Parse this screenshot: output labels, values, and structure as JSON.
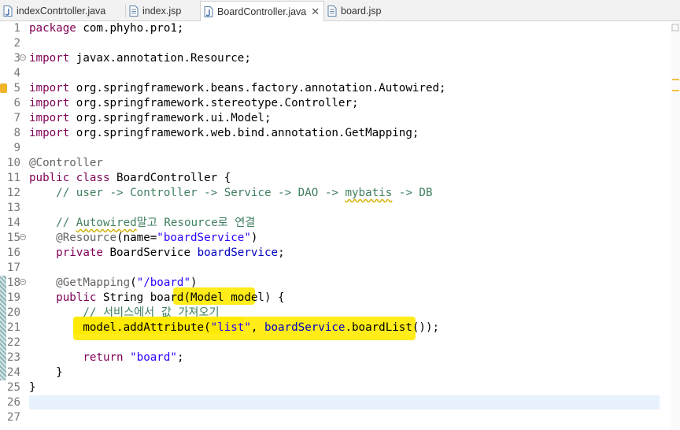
{
  "tabs": [
    {
      "label": "indexContrtoller.java",
      "type": "java",
      "active": false
    },
    {
      "label": "index.jsp",
      "type": "jsp",
      "active": false
    },
    {
      "label": "BoardController.java",
      "type": "java",
      "active": true
    },
    {
      "label": "board.jsp",
      "type": "jsp",
      "active": false
    }
  ],
  "editor": {
    "close_glyph": "✕",
    "current_line": 26,
    "highlight_color": "#ffea00",
    "lines": [
      {
        "n": "1",
        "tokens": [
          [
            "kw",
            "package"
          ],
          [
            "p",
            " com.phyho.pro1;"
          ]
        ]
      },
      {
        "n": "2",
        "tokens": []
      },
      {
        "n": "3",
        "fold": true,
        "tokens": [
          [
            "kw",
            "import"
          ],
          [
            "p",
            " javax.annotation.Resource;"
          ]
        ]
      },
      {
        "n": "4",
        "tokens": []
      },
      {
        "n": "5",
        "warn": true,
        "tokens": [
          [
            "kw",
            "import"
          ],
          [
            "p",
            " org.springframework.beans.factory.annotation.Autowired;"
          ]
        ]
      },
      {
        "n": "6",
        "tokens": [
          [
            "kw",
            "import"
          ],
          [
            "p",
            " org.springframework.stereotype.Controller;"
          ]
        ]
      },
      {
        "n": "7",
        "tokens": [
          [
            "kw",
            "import"
          ],
          [
            "p",
            " org.springframework.ui.Model;"
          ]
        ]
      },
      {
        "n": "8",
        "tokens": [
          [
            "kw",
            "import"
          ],
          [
            "p",
            " org.springframework.web.bind.annotation.GetMapping;"
          ]
        ]
      },
      {
        "n": "9",
        "tokens": []
      },
      {
        "n": "10",
        "tokens": [
          [
            "ann",
            "@Controller"
          ]
        ]
      },
      {
        "n": "11",
        "tokens": [
          [
            "kw",
            "public"
          ],
          [
            "p",
            " "
          ],
          [
            "kw",
            "class"
          ],
          [
            "p",
            " BoardController {"
          ]
        ]
      },
      {
        "n": "12",
        "tokens": [
          [
            "p",
            "    "
          ],
          [
            "cmt",
            "// user -> Controller -> Service -> DAO -> "
          ],
          [
            "cmtul",
            "mybatis"
          ],
          [
            "cmt",
            " -> DB"
          ]
        ]
      },
      {
        "n": "13",
        "tokens": []
      },
      {
        "n": "14",
        "tokens": [
          [
            "p",
            "    "
          ],
          [
            "cmt",
            "// "
          ],
          [
            "cmtul",
            "Autowired"
          ],
          [
            "cmt",
            "말고 Resource로 연결"
          ]
        ]
      },
      {
        "n": "15",
        "fold": true,
        "tokens": [
          [
            "p",
            "    "
          ],
          [
            "ann",
            "@Resource"
          ],
          [
            "p",
            "(name="
          ],
          [
            "str",
            "\"boardService\""
          ],
          [
            "p",
            ")"
          ]
        ]
      },
      {
        "n": "16",
        "tokens": [
          [
            "p",
            "    "
          ],
          [
            "kw",
            "private"
          ],
          [
            "p",
            " BoardService "
          ],
          [
            "fld",
            "boardService"
          ],
          [
            "p",
            ";"
          ]
        ]
      },
      {
        "n": "17",
        "tokens": []
      },
      {
        "n": "18",
        "fold": true,
        "tokens": [
          [
            "p",
            "    "
          ],
          [
            "ann",
            "@GetMapping"
          ],
          [
            "p",
            "("
          ],
          [
            "str",
            "\"/board\""
          ],
          [
            "p",
            ")"
          ]
        ]
      },
      {
        "n": "19",
        "tokens": [
          [
            "p",
            "    "
          ],
          [
            "kw",
            "public"
          ],
          [
            "p",
            " String board(Model model) {"
          ]
        ]
      },
      {
        "n": "20",
        "tokens": [
          [
            "p",
            "        "
          ],
          [
            "cmt",
            "// 서비스에서 값 가져오기"
          ]
        ]
      },
      {
        "n": "21",
        "tokens": [
          [
            "p",
            "        model.addAttribute("
          ],
          [
            "str",
            "\"list\""
          ],
          [
            "p",
            ", "
          ],
          [
            "fld",
            "boardService"
          ],
          [
            "p",
            ".boardList());"
          ]
        ]
      },
      {
        "n": "22",
        "tokens": []
      },
      {
        "n": "23",
        "tokens": [
          [
            "p",
            "        "
          ],
          [
            "kw",
            "return"
          ],
          [
            "p",
            " "
          ],
          [
            "str",
            "\"board\""
          ],
          [
            "p",
            ";"
          ]
        ]
      },
      {
        "n": "24",
        "tokens": [
          [
            "p",
            "    }"
          ]
        ]
      },
      {
        "n": "25",
        "tokens": [
          [
            "p",
            "}"
          ]
        ]
      },
      {
        "n": "26",
        "tokens": []
      },
      {
        "n": "27",
        "tokens": []
      }
    ]
  }
}
